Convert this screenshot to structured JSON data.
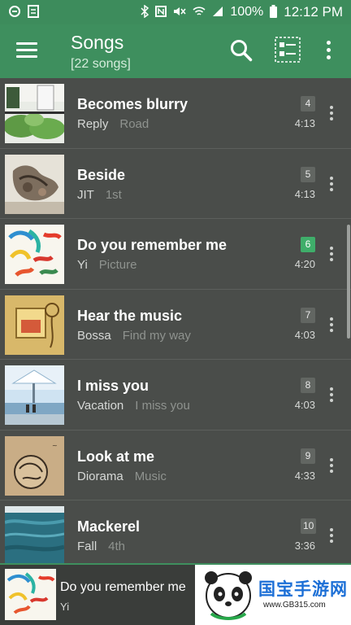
{
  "statusbar": {
    "battery": "100%",
    "time": "12:12 PM"
  },
  "appbar": {
    "title": "Songs",
    "subtitle": "[22 songs]"
  },
  "songs": [
    {
      "title": "Becomes blurry",
      "artist": "Reply",
      "album": "Road",
      "track": "4",
      "duration": "4:13",
      "active": false
    },
    {
      "title": "Beside",
      "artist": "JIT",
      "album": "1st",
      "track": "5",
      "duration": "4:13",
      "active": false
    },
    {
      "title": "Do you remember me",
      "artist": "Yi",
      "album": "Picture",
      "track": "6",
      "duration": "4:20",
      "active": true
    },
    {
      "title": "Hear the music",
      "artist": "Bossa",
      "album": "Find my way",
      "track": "7",
      "duration": "4:03",
      "active": false
    },
    {
      "title": "I miss you",
      "artist": "Vacation",
      "album": "I miss you",
      "track": "8",
      "duration": "4:03",
      "active": false
    },
    {
      "title": "Look at me",
      "artist": "Diorama",
      "album": "Music",
      "track": "9",
      "duration": "4:33",
      "active": false
    },
    {
      "title": "Mackerel",
      "artist": "Fall",
      "album": "4th",
      "track": "10",
      "duration": "3:36",
      "active": false
    }
  ],
  "player": {
    "title": "Do you remember me",
    "artist": "Yi"
  },
  "watermark": {
    "text": "国宝手游网",
    "url": "www.GB315.com"
  },
  "colors": {
    "accent": "#3e8f5e",
    "background": "#4a4d4a",
    "active_badge": "#3fae6a"
  }
}
